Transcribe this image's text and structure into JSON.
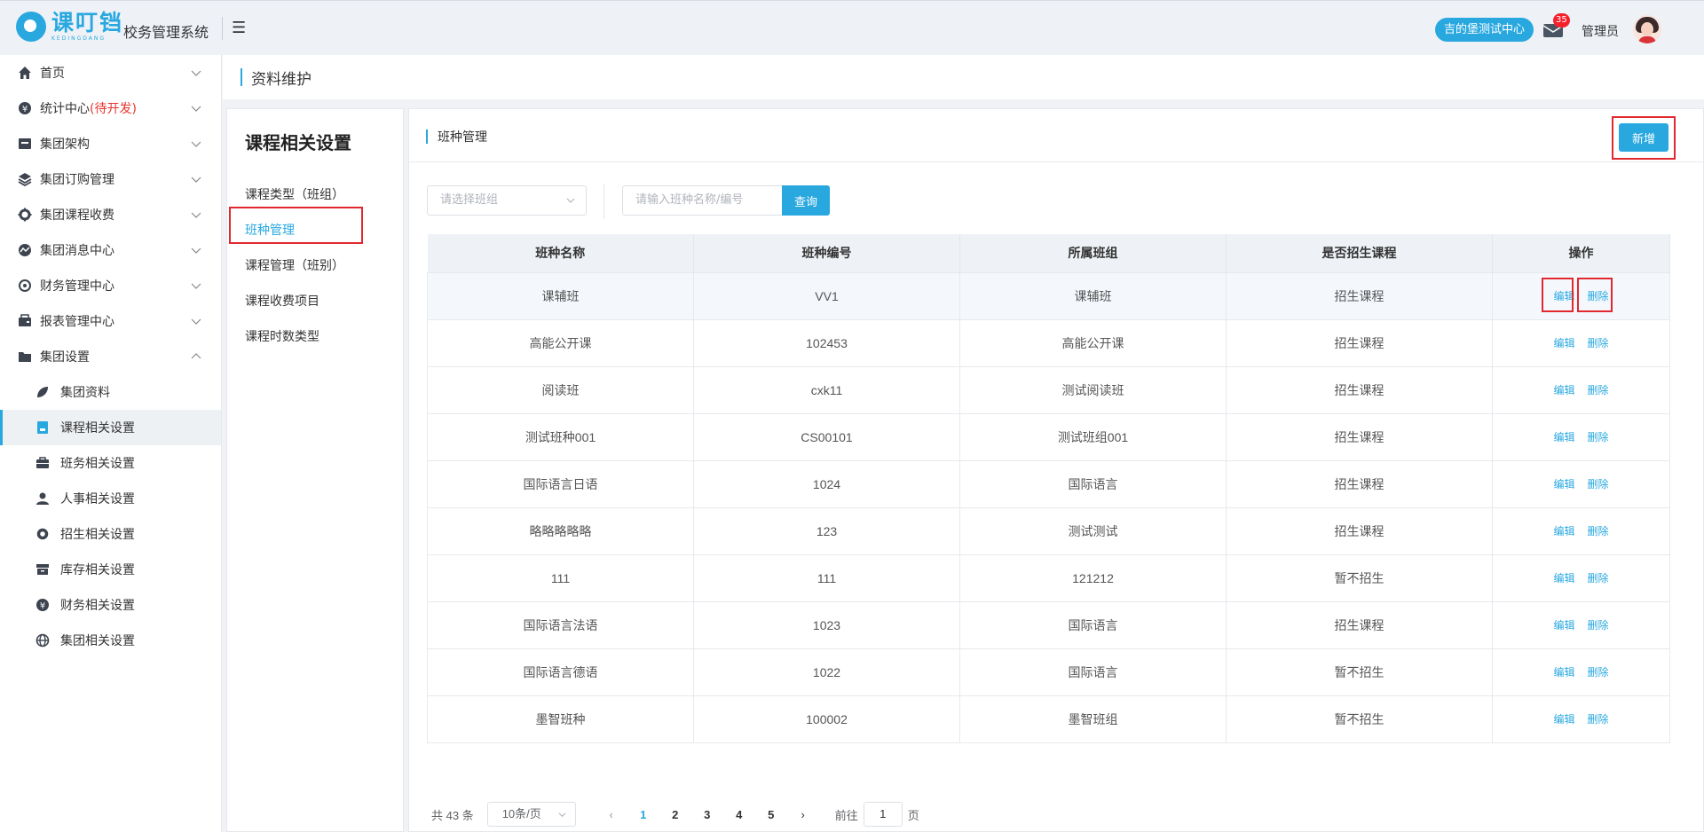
{
  "header": {
    "logo_cn": "课叮铛",
    "logo_en": "KEDINGDANG",
    "system_title": "校务管理系统",
    "campus": "吉的堡测试中心",
    "mail_count": "35",
    "user": "管理员"
  },
  "sidebar": {
    "items": [
      {
        "label": "首页",
        "icon": "home-icon"
      },
      {
        "label": "统计中心",
        "extra": "(待开发)",
        "icon": "yen-circle-icon"
      },
      {
        "label": "集团架构",
        "icon": "structure-icon"
      },
      {
        "label": "集团订购管理",
        "icon": "layers-icon"
      },
      {
        "label": "集团课程收费",
        "icon": "gear-icon"
      },
      {
        "label": "集团消息中心",
        "icon": "chart-circle-icon"
      },
      {
        "label": "财务管理中心",
        "icon": "refresh-circle-icon"
      },
      {
        "label": "报表管理中心",
        "icon": "wallet-icon"
      },
      {
        "label": "集团设置",
        "icon": "folder-icon"
      }
    ],
    "subitems": [
      {
        "label": "集团资料",
        "icon": "leaf-icon"
      },
      {
        "label": "课程相关设置",
        "icon": "book-icon"
      },
      {
        "label": "班务相关设置",
        "icon": "briefcase-icon"
      },
      {
        "label": "人事相关设置",
        "icon": "user-icon"
      },
      {
        "label": "招生相关设置",
        "icon": "cog-icon"
      },
      {
        "label": "库存相关设置",
        "icon": "box-icon"
      },
      {
        "label": "财务相关设置",
        "icon": "yen-circle-icon"
      },
      {
        "label": "集团相关设置",
        "icon": "globe-icon"
      }
    ]
  },
  "page": {
    "title": "资料维护"
  },
  "settings_panel": {
    "title": "课程相关设置",
    "links": [
      "课程类型（班组）",
      "班种管理",
      "课程管理（班别）",
      "课程收费项目",
      "课程时数类型"
    ]
  },
  "main": {
    "title": "班种管理",
    "add_label": "新增",
    "filter": {
      "select_placeholder": "请选择班组",
      "search_placeholder": "请输入班种名称/编号",
      "search_label": "查询"
    },
    "table": {
      "columns": [
        "班种名称",
        "班种编号",
        "所属班组",
        "是否招生课程",
        "操作"
      ],
      "edit_label": "编辑",
      "delete_label": "删除",
      "rows": [
        [
          "课辅班",
          "VV1",
          "课辅班",
          "招生课程"
        ],
        [
          "高能公开课",
          "102453",
          "高能公开课",
          "招生课程"
        ],
        [
          "阅读班",
          "cxk11",
          "测试阅读班",
          "招生课程"
        ],
        [
          "测试班种001",
          "CS00101",
          "测试班组001",
          "招生课程"
        ],
        [
          "国际语言日语",
          "1024",
          "国际语言",
          "招生课程"
        ],
        [
          "略略略略略",
          "123",
          "测试测试",
          "招生课程"
        ],
        [
          "111",
          "111",
          "121212",
          "暂不招生"
        ],
        [
          "国际语言法语",
          "1023",
          "国际语言",
          "招生课程"
        ],
        [
          "国际语言德语",
          "1022",
          "国际语言",
          "暂不招生"
        ],
        [
          "墨智班种",
          "100002",
          "墨智班组",
          "暂不招生"
        ]
      ]
    },
    "pagination": {
      "total": "共 43 条",
      "page_size": "10条/页",
      "pages": [
        "1",
        "2",
        "3",
        "4",
        "5"
      ],
      "current": "1",
      "goto_label": "前往",
      "goto_value": "1",
      "page_suffix": "页"
    }
  },
  "colors": {
    "accent": "#29a8e0",
    "highlight_box": "#e0282e",
    "badge": "#f5222d"
  }
}
